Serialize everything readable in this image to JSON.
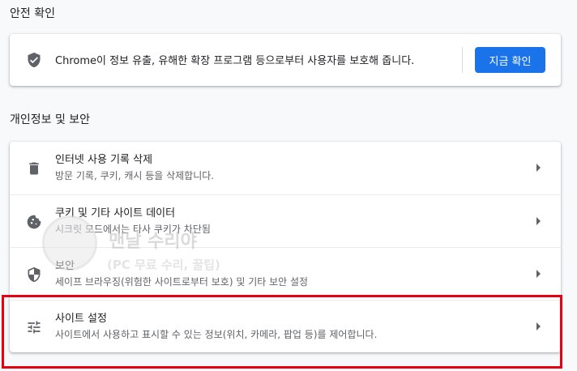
{
  "safety_check": {
    "section_title": "안전 확인",
    "description": "Chrome이 정보 유출, 유해한 확장 프로그램 등으로부터 사용자를 보호해 줍니다.",
    "button_label": "지금 확인",
    "icon": "shield-check-icon"
  },
  "privacy": {
    "section_title": "개인정보 및 보안",
    "rows": [
      {
        "title": "인터넷 사용 기록 삭제",
        "subtitle": "방문 기록, 쿠키, 캐시 등을 삭제합니다.",
        "icon": "trash-icon"
      },
      {
        "title": "쿠키 및 기타 사이트 데이터",
        "subtitle": "시크릿 모드에서는 타사 쿠키가 차단됨",
        "icon": "cookie-icon"
      },
      {
        "title": "보안",
        "subtitle": "세이프 브라우징(위험한 사이트로부터 보호) 및 기타 보안 설정",
        "icon": "shield-half-icon"
      },
      {
        "title": "사이트 설정",
        "subtitle": "사이트에서 사용하고 표시할 수 있는 정보(위치, 카메라, 팝업 등)를 제어합니다.",
        "icon": "tune-icon"
      }
    ]
  },
  "watermark": {
    "title": "맨날 수리야",
    "subtitle": "(PC 무료 수리, 꿀팁)"
  },
  "colors": {
    "accent": "#1a73e8",
    "highlight": "#e60012",
    "icon": "#5f6368",
    "background": "#f8f9fa"
  }
}
